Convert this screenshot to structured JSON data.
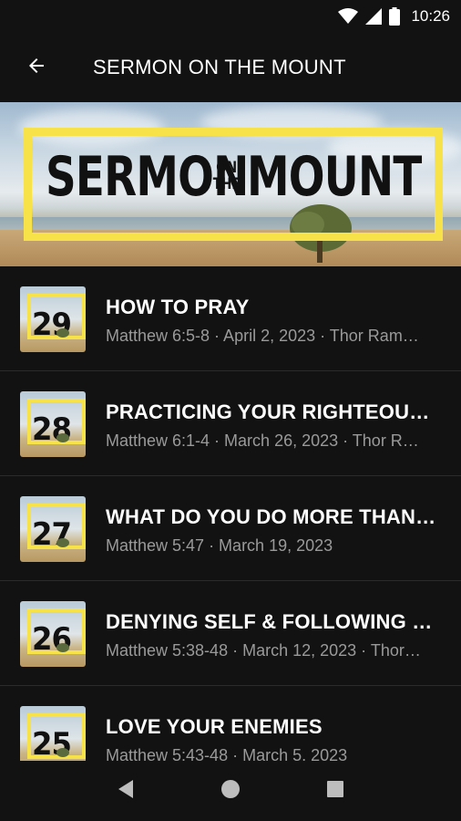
{
  "status_bar": {
    "time": "10:26",
    "icons": [
      "wifi-icon",
      "signal-icon",
      "battery-icon"
    ]
  },
  "app_bar": {
    "back_icon": "arrow-left-icon",
    "title": "SERMON ON THE MOUNT"
  },
  "banner": {
    "word1": "SERMON",
    "small_top": "ON",
    "small_bottom": "THE",
    "word2": "MOUNT",
    "accent_color": "#f7e24a"
  },
  "sermons": [
    {
      "number": "29",
      "title": "HOW TO PRAY",
      "subtitle": "Matthew 6:5-8 · April 2, 2023 · Thor Ram…"
    },
    {
      "number": "28",
      "title": "PRACTICING YOUR RIGHTEOUS…",
      "subtitle": "Matthew 6:1-4 · March 26, 2023 · Thor R…"
    },
    {
      "number": "27",
      "title": "WHAT DO YOU DO MORE THAN…",
      "subtitle": "Matthew 5:47 · March 19, 2023"
    },
    {
      "number": "26",
      "title": "DENYING SELF & FOLLOWING C…",
      "subtitle": "Matthew 5:38-48 · March 12, 2023 · Thor…"
    },
    {
      "number": "25",
      "title": "LOVE YOUR ENEMIES",
      "subtitle": "Matthew 5:43-48 · March 5, 2023"
    }
  ],
  "nav_bar": {
    "icons": [
      "back-triangle-icon",
      "home-circle-icon",
      "recents-square-icon"
    ]
  }
}
